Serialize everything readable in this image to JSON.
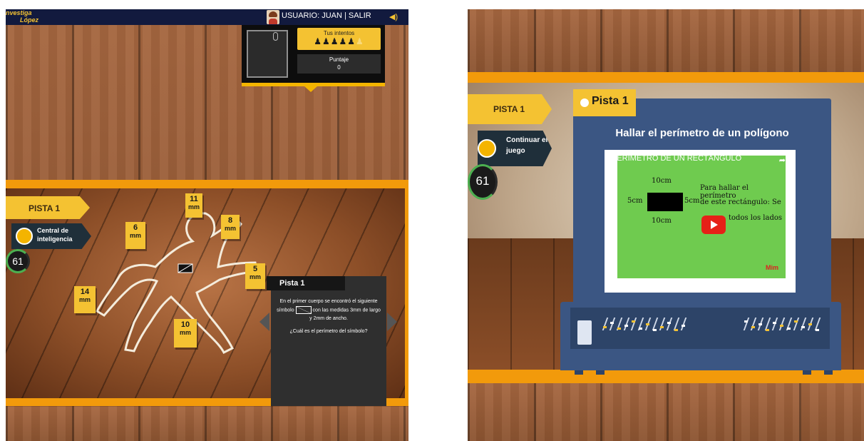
{
  "left": {
    "logo": {
      "line1": "nvestiga",
      "line2": "López"
    },
    "user_label": "USUARIO: JUAN | SALIR",
    "attempts": {
      "label": "Tus intentos",
      "icons": "♟♟♟♟♟",
      "remaining_icon": "♟"
    },
    "score": {
      "label": "Puntaje",
      "value": "0"
    },
    "pista_tag": "PISTA 1",
    "info_tag": "Central de inteligencia",
    "timer": "61",
    "markers": [
      "11",
      "6",
      "8",
      "5",
      "14",
      "10"
    ],
    "marker_unit": "mm",
    "clue_card": {
      "title": "Pista 1",
      "text_before": "En el primer cuerpo se encontró el siguiente símbolo",
      "text_after": "con las medidas 3mm de largo y 2mm de ancho.",
      "question": "¿Cuál es el perímetro del símbolo?"
    }
  },
  "right": {
    "pista_tag": "PISTA 1",
    "info_tag": "Continuar el juego",
    "timer": "61",
    "tab_title": "Pista 1",
    "monitor_title": "Hallar el perímetro de un polígono",
    "video": {
      "title": "PERÍMETRO DE UN RECTÁNGULO",
      "top_label": "10cm",
      "bottom_label": "10cm",
      "left_label": "5cm",
      "right_label": "5cm",
      "note_line1": "Para hallar el perímetro",
      "note_line2": "de este rectángulo: Se",
      "note_line3": "todos los lados",
      "brand": "Mim"
    }
  },
  "colors": {
    "accent": "#f4c232",
    "orange_border": "#f29a0b",
    "monitor": "#3b5683",
    "navbar": "#121a3e"
  }
}
